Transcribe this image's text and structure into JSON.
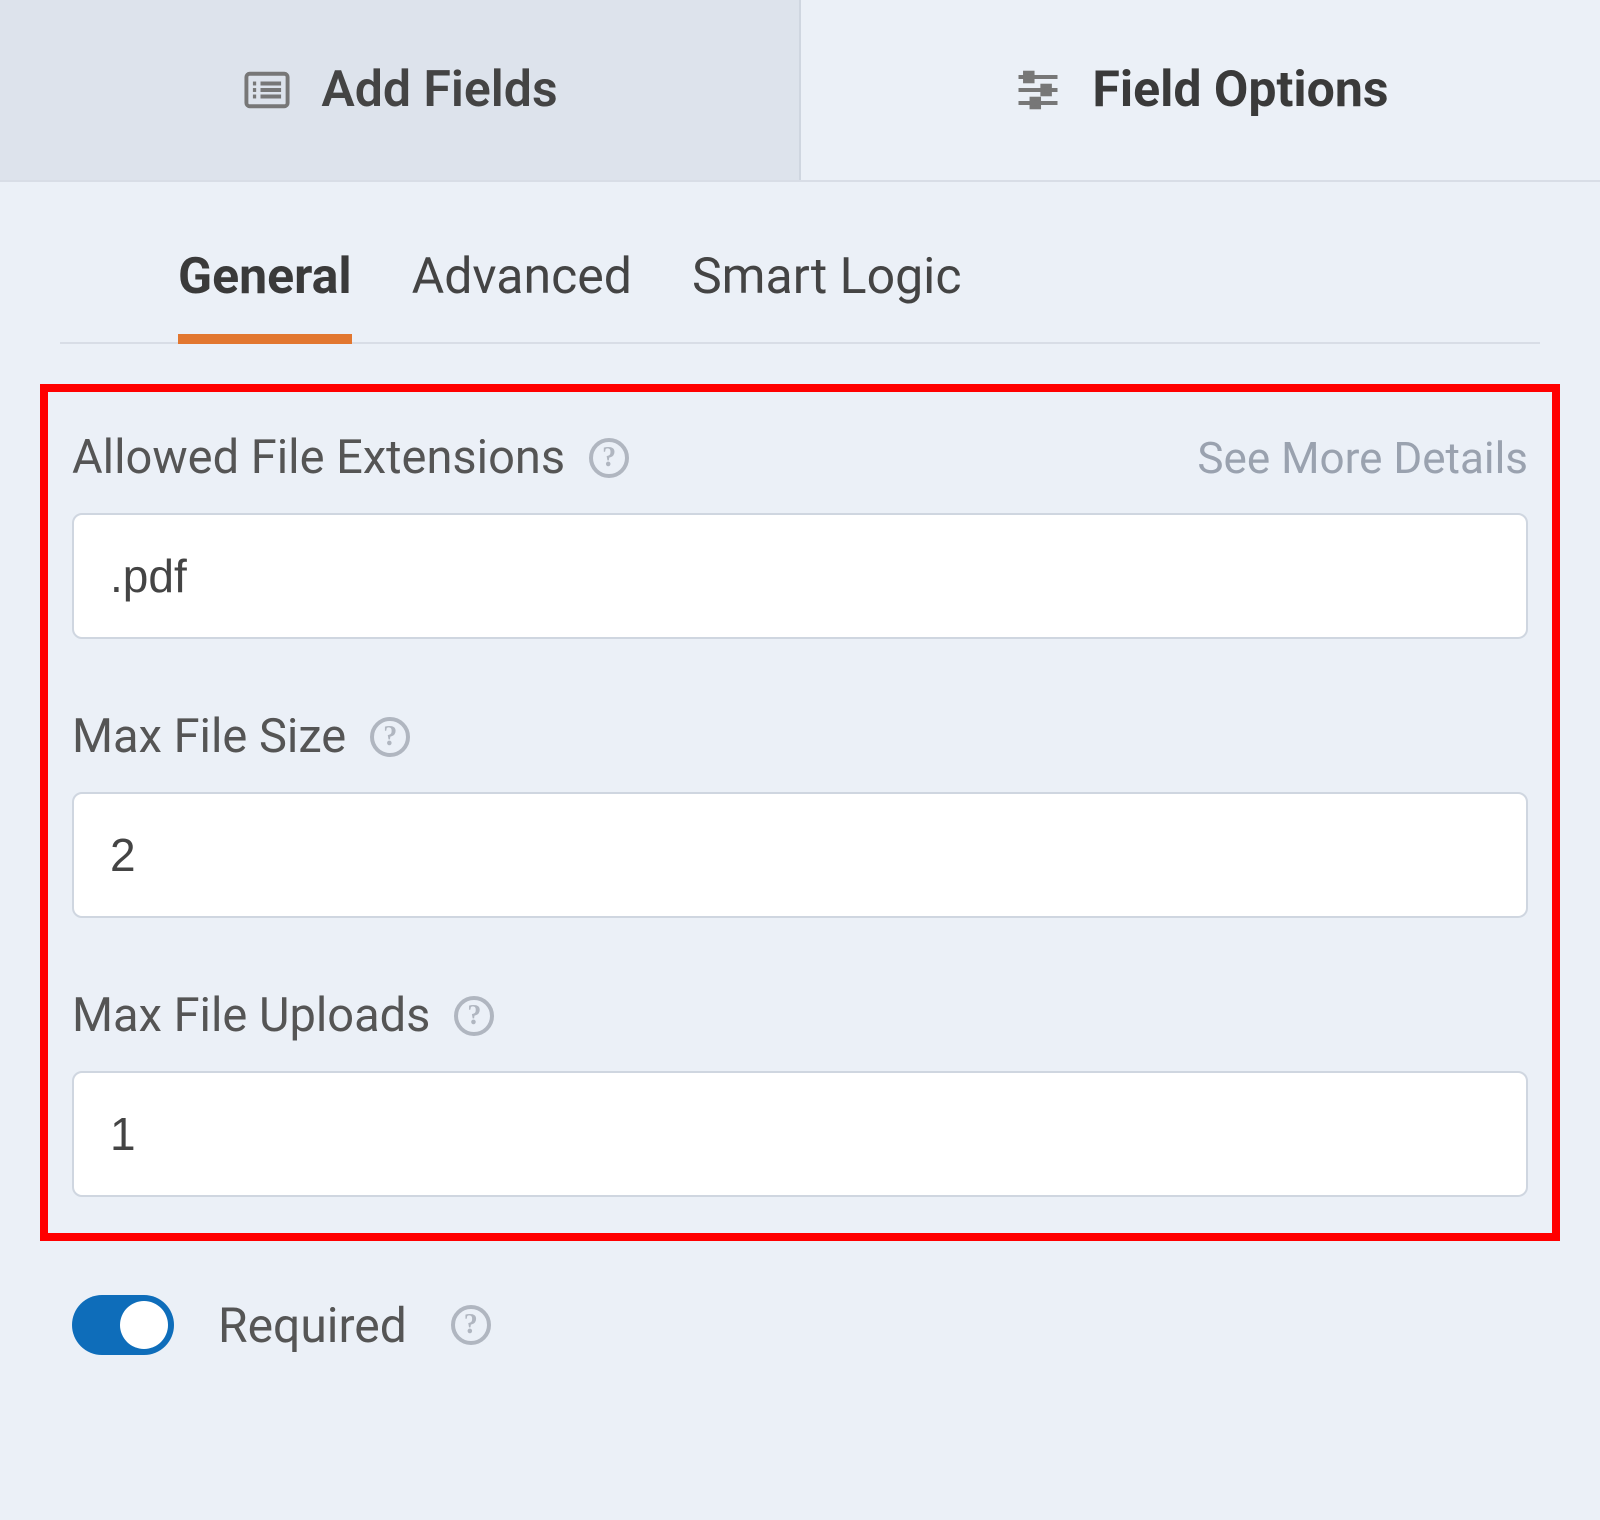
{
  "topnav": {
    "add_fields": "Add Fields",
    "field_options": "Field Options"
  },
  "subtabs": {
    "general": "General",
    "advanced": "Advanced",
    "smart_logic": "Smart Logic"
  },
  "see_more": "See More Details",
  "fields": {
    "allowed_extensions": {
      "label": "Allowed File Extensions",
      "value": ".pdf"
    },
    "max_file_size": {
      "label": "Max File Size",
      "value": "2"
    },
    "max_file_uploads": {
      "label": "Max File Uploads",
      "value": "1"
    }
  },
  "required": {
    "label": "Required",
    "enabled": true
  }
}
